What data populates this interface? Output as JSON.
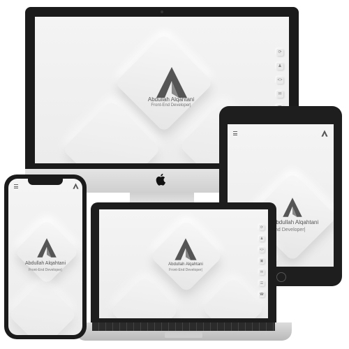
{
  "brand": {
    "name": "Abdullah Alqahtani",
    "role": "Front-End Developer|",
    "logo_letter": "A"
  },
  "desktop": {
    "sidebar_icons": [
      "refresh-icon",
      "user-icon",
      "code-icon",
      "mail-icon",
      "chat-icon"
    ]
  },
  "laptop": {
    "sidebar_icons": [
      "refresh-icon",
      "user-icon",
      "code-icon",
      "briefcase-icon",
      "mail-icon",
      "chat-icon",
      "phone-icon"
    ]
  },
  "tablet": {
    "name_visible": "Abdullah Alqahtani",
    "role_visible": "nd Developer|"
  },
  "colors": {
    "bezel": "#1b1b1b",
    "screen": "#efefef",
    "silver": "#d6d6d6",
    "logo_dark": "#555555"
  }
}
